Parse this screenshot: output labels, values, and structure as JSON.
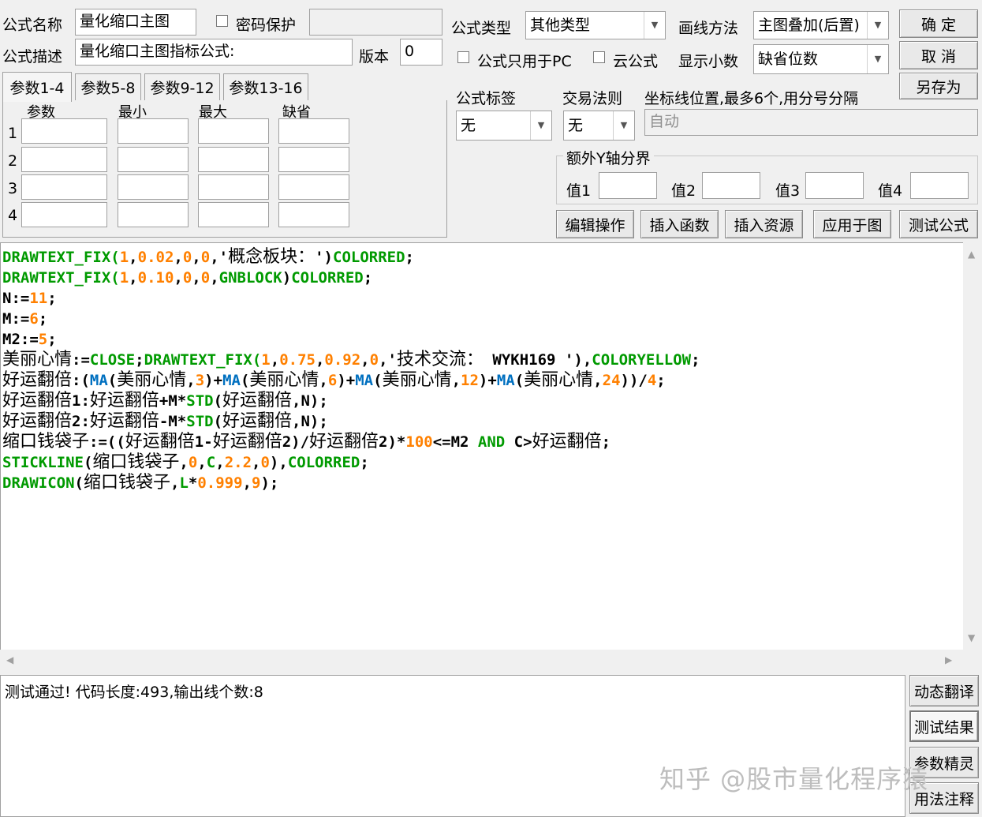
{
  "header": {
    "formula_name_label": "公式名称",
    "formula_name_value": "量化缩口主图",
    "password_label": "密码保护",
    "password_value": "",
    "formula_desc_label": "公式描述",
    "formula_desc_value": "量化缩口主图指标公式:",
    "version_label": "版本",
    "version_value": "0",
    "formula_type_label": "公式类型",
    "formula_type_value": "其他类型",
    "draw_method_label": "画线方法",
    "draw_method_value": "主图叠加(后置)",
    "pc_only_label": "公式只用于PC",
    "cloud_label": "云公式",
    "decimals_label": "显示小数",
    "decimals_value": "缺省位数",
    "tag_label": "公式标签",
    "tag_value": "无",
    "trade_rule_label": "交易法则",
    "trade_rule_value": "无",
    "coord_label": "坐标线位置,最多6个,用分号分隔",
    "coord_placeholder": "自动",
    "extra_y_label": "额外Y轴分界",
    "val1": "值1",
    "val2": "值2",
    "val3": "值3",
    "val4": "值4"
  },
  "buttons": {
    "ok": "确  定",
    "cancel": "取  消",
    "save_as": "另存为",
    "edit_ops": "编辑操作",
    "insert_func": "插入函数",
    "insert_res": "插入资源",
    "apply_chart": "应用于图",
    "test_formula": "测试公式"
  },
  "param_tabs": [
    "参数1-4",
    "参数5-8",
    "参数9-12",
    "参数13-16"
  ],
  "param_headers": [
    "参数",
    "最小",
    "最大",
    "缺省"
  ],
  "param_rows": [
    "1",
    "2",
    "3",
    "4"
  ],
  "code_lines": [
    [
      [
        "DRAWTEXT_FIX(",
        "g"
      ],
      [
        "1",
        "o"
      ],
      [
        ",",
        "k"
      ],
      [
        "0.02",
        "o"
      ],
      [
        ",",
        "k"
      ],
      [
        "0",
        "o"
      ],
      [
        ",",
        "k"
      ],
      [
        "0",
        "o"
      ],
      [
        ",'",
        "k"
      ],
      [
        "概念板块：",
        "c"
      ],
      [
        "')",
        "k"
      ],
      [
        "COLORRED",
        "g"
      ],
      [
        ";",
        "k"
      ]
    ],
    [
      [
        "DRAWTEXT_FIX(",
        "g"
      ],
      [
        "1",
        "o"
      ],
      [
        ",",
        "k"
      ],
      [
        "0.10",
        "o"
      ],
      [
        ",",
        "k"
      ],
      [
        "0",
        "o"
      ],
      [
        ",",
        "k"
      ],
      [
        "0",
        "o"
      ],
      [
        ",",
        "k"
      ],
      [
        "GNBLOCK",
        "g"
      ],
      [
        ")",
        "k"
      ],
      [
        "COLORRED",
        "g"
      ],
      [
        ";",
        "k"
      ]
    ],
    [
      [
        "N:=",
        "k"
      ],
      [
        "11",
        "o"
      ],
      [
        ";",
        "k"
      ]
    ],
    [
      [
        "M:=",
        "k"
      ],
      [
        "6",
        "o"
      ],
      [
        ";",
        "k"
      ]
    ],
    [
      [
        "M2:=",
        "k"
      ],
      [
        "5",
        "o"
      ],
      [
        ";",
        "k"
      ]
    ],
    [
      [
        "美丽心情",
        "c"
      ],
      [
        ":=",
        "k"
      ],
      [
        "CLOSE",
        "g"
      ],
      [
        ";",
        "k"
      ],
      [
        "DRAWTEXT_FIX(",
        "g"
      ],
      [
        "1",
        "o"
      ],
      [
        ",",
        "k"
      ],
      [
        "0.75",
        "o"
      ],
      [
        ",",
        "k"
      ],
      [
        "0.92",
        "o"
      ],
      [
        ",",
        "k"
      ],
      [
        "0",
        "o"
      ],
      [
        ",'",
        "k"
      ],
      [
        "技术交流：",
        "c"
      ],
      [
        " WYKH169 ')",
        "k"
      ],
      [
        ",",
        "k"
      ],
      [
        "COLORYELLOW",
        "g"
      ],
      [
        ";",
        "k"
      ]
    ],
    [
      [
        "好运翻倍",
        "c"
      ],
      [
        ":(",
        "k"
      ],
      [
        "MA",
        "b"
      ],
      [
        "(",
        "k"
      ],
      [
        "美丽心情",
        "c"
      ],
      [
        ",",
        "k"
      ],
      [
        "3",
        "o"
      ],
      [
        ")+",
        "k"
      ],
      [
        "MA",
        "b"
      ],
      [
        "(",
        "k"
      ],
      [
        "美丽心情",
        "c"
      ],
      [
        ",",
        "k"
      ],
      [
        "6",
        "o"
      ],
      [
        ")+",
        "k"
      ],
      [
        "MA",
        "b"
      ],
      [
        "(",
        "k"
      ],
      [
        "美丽心情",
        "c"
      ],
      [
        ",",
        "k"
      ],
      [
        "12",
        "o"
      ],
      [
        ")+",
        "k"
      ],
      [
        "MA",
        "b"
      ],
      [
        "(",
        "k"
      ],
      [
        "美丽心情",
        "c"
      ],
      [
        ",",
        "k"
      ],
      [
        "24",
        "o"
      ],
      [
        "))/",
        "k"
      ],
      [
        "4",
        "o"
      ],
      [
        ";",
        "k"
      ]
    ],
    [
      [
        "好运翻倍",
        "c"
      ],
      [
        "1:",
        "k"
      ],
      [
        "好运翻倍",
        "c"
      ],
      [
        "+M*",
        "k"
      ],
      [
        "STD",
        "g"
      ],
      [
        "(",
        "k"
      ],
      [
        "好运翻倍",
        "c"
      ],
      [
        ",N);",
        "k"
      ]
    ],
    [
      [
        "好运翻倍",
        "c"
      ],
      [
        "2:",
        "k"
      ],
      [
        "好运翻倍",
        "c"
      ],
      [
        "-M*",
        "k"
      ],
      [
        "STD",
        "g"
      ],
      [
        "(",
        "k"
      ],
      [
        "好运翻倍",
        "c"
      ],
      [
        ",N);",
        "k"
      ]
    ],
    [
      [
        "缩口钱袋子",
        "c"
      ],
      [
        ":=((",
        "k"
      ],
      [
        "好运翻倍",
        "c"
      ],
      [
        "1-",
        "k"
      ],
      [
        "好运翻倍",
        "c"
      ],
      [
        "2)/",
        "k"
      ],
      [
        "好运翻倍",
        "c"
      ],
      [
        "2)*",
        "k"
      ],
      [
        "100",
        "o"
      ],
      [
        "<=M2 ",
        "k"
      ],
      [
        "AND",
        "g"
      ],
      [
        " C>",
        "k"
      ],
      [
        "好运翻倍",
        "c"
      ],
      [
        ";",
        "k"
      ]
    ],
    [
      [
        "STICKLINE",
        "g"
      ],
      [
        "(",
        "k"
      ],
      [
        "缩口钱袋子",
        "c"
      ],
      [
        ",",
        "k"
      ],
      [
        "0",
        "o"
      ],
      [
        ",",
        "k"
      ],
      [
        "C",
        "g"
      ],
      [
        ",",
        "k"
      ],
      [
        "2.2",
        "o"
      ],
      [
        ",",
        "k"
      ],
      [
        "0",
        "o"
      ],
      [
        "),",
        "k"
      ],
      [
        "COLORRED",
        "g"
      ],
      [
        ";",
        "k"
      ]
    ],
    [
      [
        "DRAWICON",
        "g"
      ],
      [
        "(",
        "k"
      ],
      [
        "缩口钱袋子",
        "c"
      ],
      [
        ",",
        "k"
      ],
      [
        "L",
        "g"
      ],
      [
        "*",
        "k"
      ],
      [
        "0.999",
        "o"
      ],
      [
        ",",
        "k"
      ],
      [
        "9",
        "o"
      ],
      [
        ");",
        "k"
      ]
    ]
  ],
  "output_text": "测试通过! 代码长度:493,输出线个数:8",
  "side_buttons": [
    "动态翻译",
    "测试结果",
    "参数精灵",
    "用法注释"
  ],
  "watermark": "知乎 @股市量化程序猿"
}
